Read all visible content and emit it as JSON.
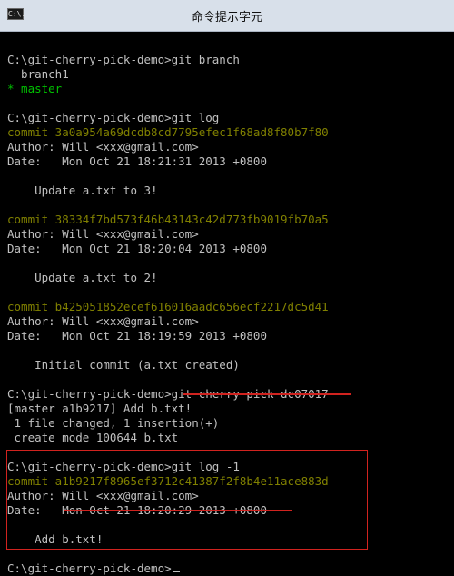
{
  "window": {
    "title": "命令提示字元",
    "icon": "cmd-icon",
    "icon_text": "C:\\."
  },
  "colors": {
    "yellow": "#808000",
    "green": "#00c000",
    "text": "#c0c0c0",
    "highlight": "#d1231f"
  },
  "console": {
    "lines": [
      {
        "text": ""
      },
      {
        "text": "C:\\git-cherry-pick-demo>git branch"
      },
      {
        "text": "  branch1"
      },
      {
        "text": "* master",
        "color": "green"
      },
      {
        "text": ""
      },
      {
        "text": "C:\\git-cherry-pick-demo>git log"
      },
      {
        "text": "commit 3a0a954a69dcdb8cd7795efec1f68ad8f80b7f80",
        "color": "yellow"
      },
      {
        "text": "Author: Will <xxx@gmail.com>"
      },
      {
        "text": "Date:   Mon Oct 21 18:21:31 2013 +0800"
      },
      {
        "text": ""
      },
      {
        "text": "    Update a.txt to 3!"
      },
      {
        "text": ""
      },
      {
        "text": "commit 38334f7bd573f46b43143c42d773fb9019fb70a5",
        "color": "yellow"
      },
      {
        "text": "Author: Will <xxx@gmail.com>"
      },
      {
        "text": "Date:   Mon Oct 21 18:20:04 2013 +0800"
      },
      {
        "text": ""
      },
      {
        "text": "    Update a.txt to 2!"
      },
      {
        "text": ""
      },
      {
        "text": "commit b425051852ecef616016aadc656ecf2217dc5d41",
        "color": "yellow"
      },
      {
        "text": "Author: Will <xxx@gmail.com>"
      },
      {
        "text": "Date:   Mon Oct 21 18:19:59 2013 +0800"
      },
      {
        "text": ""
      },
      {
        "text": "    Initial commit (a.txt created)"
      },
      {
        "text": ""
      },
      {
        "text": "C:\\git-cherry-pick-demo>git cherry-pick dc07017"
      },
      {
        "text": "[master a1b9217] Add b.txt!"
      },
      {
        "text": " 1 file changed, 1 insertion(+)"
      },
      {
        "text": " create mode 100644 b.txt"
      },
      {
        "text": ""
      },
      {
        "text": "C:\\git-cherry-pick-demo>git log -1"
      },
      {
        "text": "commit a1b9217f8965ef3712c41387f2f8b4e11ace883d",
        "color": "yellow"
      },
      {
        "text": "Author: Will <xxx@gmail.com>"
      },
      {
        "text": "Date:   Mon Oct 21 18:20:29 2013 +0800"
      },
      {
        "text": ""
      },
      {
        "text": "    Add b.txt!"
      },
      {
        "text": ""
      },
      {
        "text": "C:\\git-cherry-pick-demo>",
        "cursor": true
      }
    ]
  }
}
